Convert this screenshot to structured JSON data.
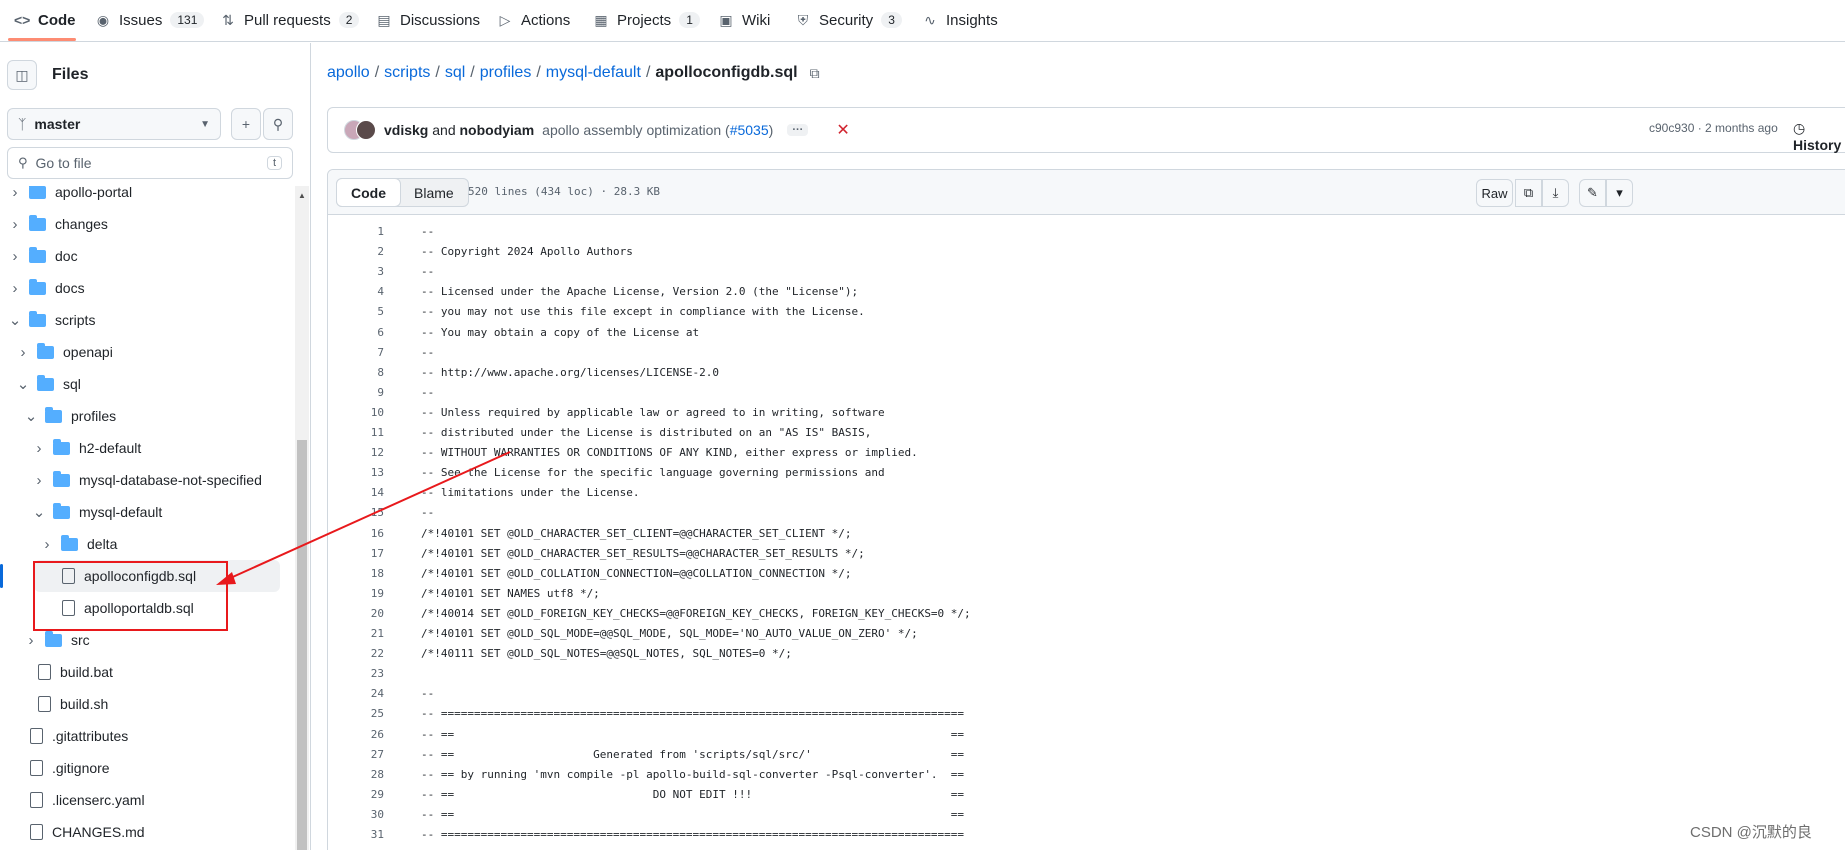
{
  "nav": {
    "tabs": [
      {
        "label": "Code",
        "icon": "code-icon",
        "count": ""
      },
      {
        "label": "Issues",
        "icon": "issue-icon",
        "count": "131"
      },
      {
        "label": "Pull requests",
        "icon": "pull-request-icon",
        "count": "2"
      },
      {
        "label": "Discussions",
        "icon": "discussion-icon",
        "count": ""
      },
      {
        "label": "Actions",
        "icon": "play-icon",
        "count": ""
      },
      {
        "label": "Projects",
        "icon": "table-icon",
        "count": "1"
      },
      {
        "label": "Wiki",
        "icon": "book-icon",
        "count": ""
      },
      {
        "label": "Security",
        "icon": "shield-icon",
        "count": "3"
      },
      {
        "label": "Insights",
        "icon": "graph-icon",
        "count": ""
      }
    ]
  },
  "sidebar": {
    "title": "Files",
    "branch": "master",
    "goto_placeholder": "Go to file",
    "goto_shortcut": "t",
    "tree": [
      {
        "label": "apollo-portal",
        "type": "folder",
        "depth": 0
      },
      {
        "label": "changes",
        "type": "folder",
        "depth": 0
      },
      {
        "label": "doc",
        "type": "folder",
        "depth": 0
      },
      {
        "label": "docs",
        "type": "folder",
        "depth": 0
      },
      {
        "label": "scripts",
        "type": "folder-open",
        "depth": 0
      },
      {
        "label": "openapi",
        "type": "folder",
        "depth": 1
      },
      {
        "label": "sql",
        "type": "folder-open",
        "depth": 1
      },
      {
        "label": "profiles",
        "type": "folder-open",
        "depth": 2
      },
      {
        "label": "h2-default",
        "type": "folder",
        "depth": 3
      },
      {
        "label": "mysql-database-not-specified",
        "type": "folder",
        "depth": 3
      },
      {
        "label": "mysql-default",
        "type": "folder-open",
        "depth": 3
      },
      {
        "label": "delta",
        "type": "folder",
        "depth": 4
      },
      {
        "label": "apolloconfigdb.sql",
        "type": "file",
        "depth": 4,
        "selected": true
      },
      {
        "label": "apolloportaldb.sql",
        "type": "file",
        "depth": 4
      },
      {
        "label": "src",
        "type": "folder",
        "depth": 2
      },
      {
        "label": "build.bat",
        "type": "file",
        "depth": 1
      },
      {
        "label": "build.sh",
        "type": "file",
        "depth": 1
      },
      {
        "label": ".gitattributes",
        "type": "file",
        "depth": 0
      },
      {
        "label": ".gitignore",
        "type": "file",
        "depth": 0
      },
      {
        "label": ".licenserc.yaml",
        "type": "file",
        "depth": 0
      },
      {
        "label": "CHANGES.md",
        "type": "file",
        "depth": 0
      }
    ]
  },
  "breadcrumb": {
    "parts": [
      "apollo",
      "scripts",
      "sql",
      "profiles",
      "mysql-default"
    ],
    "current": "apolloconfigdb.sql"
  },
  "commit": {
    "author1": "vdiskg",
    "and": "and",
    "author2": "nobodyiam",
    "message": "apollo assembly optimization (",
    "pr": "#5035",
    "message_end": ")",
    "meta": "c90c930 · 2 months ago",
    "history": "History"
  },
  "viewer": {
    "tab_code": "Code",
    "tab_blame": "Blame",
    "info": "520 lines (434 loc) · 28.3 KB",
    "raw": "Raw"
  },
  "code": [
    "--",
    "-- Copyright 2024 Apollo Authors",
    "--",
    "-- Licensed under the Apache License, Version 2.0 (the \"License\");",
    "-- you may not use this file except in compliance with the License.",
    "-- You may obtain a copy of the License at",
    "--",
    "-- http://www.apache.org/licenses/LICENSE-2.0",
    "--",
    "-- Unless required by applicable law or agreed to in writing, software",
    "-- distributed under the License is distributed on an \"AS IS\" BASIS,",
    "-- WITHOUT WARRANTIES OR CONDITIONS OF ANY KIND, either express or implied.",
    "-- See the License for the specific language governing permissions and",
    "-- limitations under the License.",
    "--",
    "/*!40101 SET @OLD_CHARACTER_SET_CLIENT=@@CHARACTER_SET_CLIENT */;",
    "/*!40101 SET @OLD_CHARACTER_SET_RESULTS=@@CHARACTER_SET_RESULTS */;",
    "/*!40101 SET @OLD_COLLATION_CONNECTION=@@COLLATION_CONNECTION */;",
    "/*!40101 SET NAMES utf8 */;",
    "/*!40014 SET @OLD_FOREIGN_KEY_CHECKS=@@FOREIGN_KEY_CHECKS, FOREIGN_KEY_CHECKS=0 */;",
    "/*!40101 SET @OLD_SQL_MODE=@@SQL_MODE, SQL_MODE='NO_AUTO_VALUE_ON_ZERO' */;",
    "/*!40111 SET @OLD_SQL_NOTES=@@SQL_NOTES, SQL_NOTES=0 */;",
    "",
    "--",
    "-- ===============================================================================",
    "-- ==                                                                           ==",
    "-- ==                     Generated from 'scripts/sql/src/'                     ==",
    "-- == by running 'mvn compile -pl apollo-build-sql-converter -Psql-converter'.  ==",
    "-- ==                              DO NOT EDIT !!!                              ==",
    "-- ==                                                                           ==",
    "-- ==============================================================================="
  ],
  "watermark": "CSDN @沉默的良",
  "colors": {
    "accent": "#0969da",
    "annotation": "#e8191c",
    "folder": "#54aeff"
  }
}
